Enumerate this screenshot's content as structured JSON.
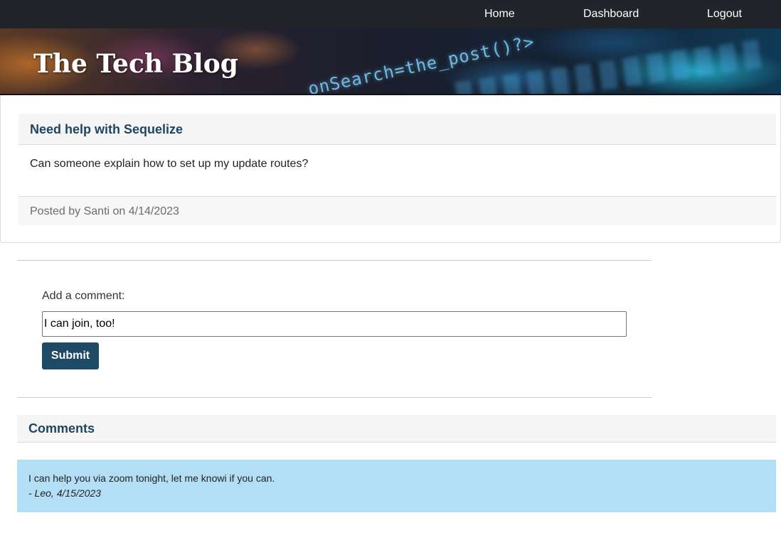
{
  "nav": {
    "links": [
      {
        "label": "Home"
      },
      {
        "label": "Dashboard"
      },
      {
        "label": "Logout"
      }
    ]
  },
  "banner": {
    "site_title": "The Tech Blog",
    "background_code_text": "onSearch=the_post()?>"
  },
  "post": {
    "title": "Need help with Sequelize",
    "body": "Can someone explain how to set up my update routes?",
    "meta": "Posted by Santi on 4/14/2023"
  },
  "comment_form": {
    "label": "Add a comment:",
    "input_value": "I can join, too!",
    "submit_label": "Submit"
  },
  "comments": {
    "title": "Comments",
    "items": [
      {
        "text": "I can help you via zoom tonight, let me knowi if you can.",
        "meta": "- Leo, 4/15/2023"
      }
    ]
  },
  "colors": {
    "navbar": "#212529",
    "heading": "#1f4560",
    "button": "#1f4a66",
    "comment_bg": "#b3dff6"
  }
}
